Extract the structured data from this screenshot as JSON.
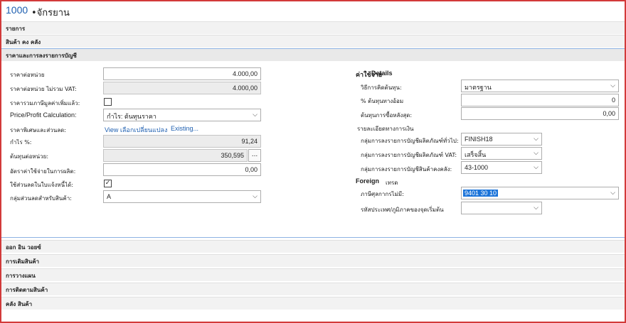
{
  "title": {
    "no": "1000",
    "name": "•จักรยาน"
  },
  "tabs": {
    "items": "รายการ",
    "inventory": "สินค้า คง คลัง",
    "price_posting": "ราคาและการลงรายการบัญชี",
    "foreign_trade": "ออก อิน วอยซ์",
    "replenishment": "การเติมสินค้า",
    "planning": "การวางแผน",
    "item_tracking": "การติดตามสินค้า",
    "warehouse": "คลัง สินค้า"
  },
  "left": {
    "unit_price_label": "ราคาต่อหน่วย",
    "unit_price": "4.000,00",
    "unit_price_excl_vat_label": "ราคาต่อหน่วย  ไม่รวม VAT:",
    "unit_price_excl_vat": "4.000,00",
    "price_incl_vat_label": "ราคารวมภาษีมูลค่าเพิ่มแล้ว:",
    "price_profit_label": "Price/Profit Calculation:",
    "price_profit_value": "กำไร: ต้นทุนราคา",
    "special_prices_label": "ราคาพิเศษและส่วนลด:",
    "special_prices_link": "View เลือกเปลี่ยนแปลง",
    "existing_link": "Existing...",
    "profit_label": "กำไร  %:",
    "profit_value": "91,24",
    "unit_cost_label": "ต้นทุนต่อหน่วย:",
    "unit_cost_value": "350,595",
    "unit_cost_btn": "...",
    "overhead_label": "อัตราค่าใช้จ่ายในการผลิต:",
    "overhead_value": "0,00",
    "allow_inv_disc_label": "ใช้ส่วนลดในใบแจ้งหนี้ได้:",
    "allow_inv_disc_check": "✓",
    "item_disc_group_label": "กลุ่มส่วนลดสำหรับสินค้า:",
    "item_disc_group_value": "A"
  },
  "right": {
    "cost_details_label": "ค่าใช้จ่าย",
    "cost_details_label2": "Details",
    "costing_method_label": "วิธีการคิดต้นทุน:",
    "costing_method_value": "มาตรฐาน",
    "indirect_cost_label": "% ต้นทุนทางอ้อม",
    "indirect_cost_value": "0",
    "last_direct_cost_label": "ต้นทุนการซื้อหลังสุด:",
    "last_direct_cost_value": "0,00",
    "financial_details_label": "รายละเอียดทางการเงิน",
    "gen_prod_posting_label": "กลุ่มการลงรายการบัญชีผลิตภัณฑ์ทั่วไป:",
    "gen_prod_posting_value": "FINISH18",
    "vat_prod_posting_label": "กลุ่มการลงรายการบัญชีผลิตภัณฑ์ VAT:",
    "vat_prod_posting_value": "เสร็จสิ้น",
    "inventory_posting_label": "กลุ่มการลงรายการบัญชีสินค้าคงคลัง:",
    "inventory_posting_value": "43-1000",
    "foreign_trade_label": "Foreign",
    "foreign_trade_label2": "เทรด",
    "tariff_no_label": "ภาษีศุลกากรไม่มี:",
    "tariff_no_value": "9401 30 10",
    "country_origin_label": "รหัสประเทศ/ภูมิภาคของจุดเริ่มต้น"
  },
  "icons": {
    "dropdown": "chevron-down-icon"
  }
}
